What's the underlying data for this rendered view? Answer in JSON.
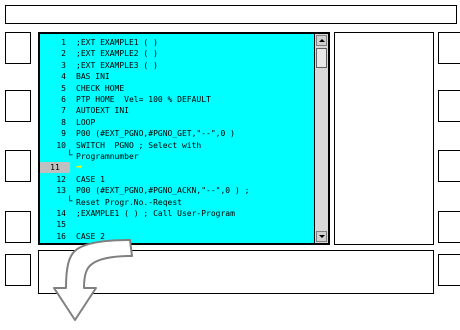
{
  "editor": {
    "lines": [
      {
        "num": "1",
        "code": ";EXT EXAMPLE1 ( )"
      },
      {
        "num": "2",
        "code": ";EXT EXAMPLE2 ( )"
      },
      {
        "num": "3",
        "code": ";EXT EXAMPLE3 ( )"
      },
      {
        "num": "4",
        "code": "BAS INI"
      },
      {
        "num": "5",
        "code": "CHECK HOME"
      },
      {
        "num": "6",
        "code": "PTP HOME  Vel= 100 % DEFAULT"
      },
      {
        "num": "7",
        "code": "AUTOEXT INI"
      },
      {
        "num": "8",
        "code": "LOOP"
      },
      {
        "num": "9",
        "code": "P00 (#EXT_PGNO,#PGNO_GET,\"--\",0 )"
      },
      {
        "num": "10",
        "code": "SWITCH  PGNO ; Select with"
      },
      {
        "num": "",
        "code": "Programnumber",
        "continuation": true
      },
      {
        "num": "11",
        "code": "",
        "current": true
      },
      {
        "num": "12",
        "code": "CASE 1"
      },
      {
        "num": "13",
        "code": "P00 (#EXT_PGNO,#PGNO_ACKN,\"--\",0 ) ;"
      },
      {
        "num": "",
        "code": "Reset Progr.No.-Reqest",
        "continuation": true
      },
      {
        "num": "14",
        "code": ";EXAMPLE1 ( ) ; Call User-Program"
      },
      {
        "num": "15",
        "code": ""
      },
      {
        "num": "16",
        "code": "CASE 2"
      }
    ],
    "colors": {
      "background": "#00ffff",
      "current_line_marker": "#c0c0c0",
      "cursor_arrow": "#ffff00"
    }
  },
  "icons": {
    "cursor": "right-arrow-icon",
    "continuation": "line-wrap-icon",
    "scroll_up": "triangle-up-icon",
    "scroll_down": "triangle-down-icon",
    "big_arrow": "curved-down-arrow-icon"
  }
}
